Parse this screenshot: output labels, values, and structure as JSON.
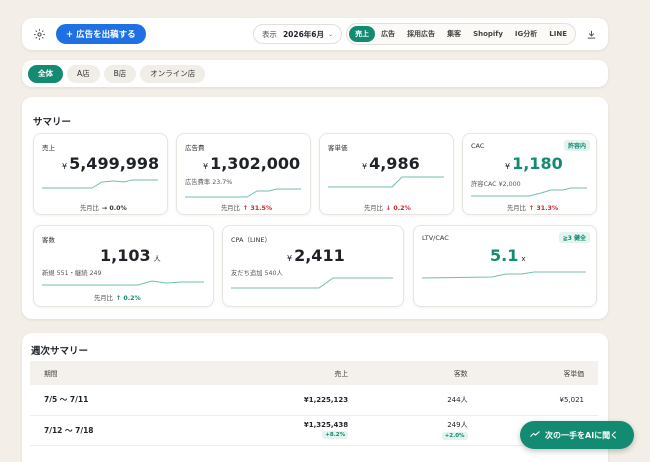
{
  "topbar": {
    "cta_label": "+ 広告を出稿する",
    "period_label": "表示",
    "period_value": "2026年6月",
    "tabs": [
      "売上",
      "広告",
      "採用広告",
      "集客",
      "Shopify",
      "IG分析",
      "LINE"
    ]
  },
  "stores": [
    "全体",
    "A店",
    "B店",
    "オンライン店"
  ],
  "summary": {
    "title": "サマリー",
    "sales": {
      "title": "売上",
      "yen": "¥",
      "value": "5,499,998",
      "cmp_label": "先月比",
      "cmp_value": "→ 0.0%"
    },
    "ad_cost": {
      "title": "広告費",
      "yen": "¥",
      "value": "1,302,000",
      "sub": "広告費率 23.7%",
      "cmp_label": "先月比",
      "cmp_value": "↑ 31.5%"
    },
    "avg_price": {
      "title": "客単価",
      "yen": "¥",
      "value": "4,986",
      "cmp_label": "先月比",
      "cmp_value": "↓ 0.2%"
    },
    "cac": {
      "title": "CAC",
      "badge": "許容内",
      "yen": "¥",
      "value": "1,180",
      "sub": "許容CAC ¥2,000",
      "cmp_label": "先月比",
      "cmp_value": "↑ 31.3%"
    },
    "customers": {
      "title": "客数",
      "value": "1,103",
      "unit": "人",
      "sub": "新規 551・継続 249",
      "cmp_label": "先月比",
      "cmp_value": "↑ 0.2%"
    },
    "cpa": {
      "title": "CPA（LINE）",
      "yen": "¥",
      "value": "2,411",
      "sub": "友だち追加 540人"
    },
    "ltv_cac": {
      "title": "LTV/CAC",
      "badge": "≧3 健全",
      "value": "5.1",
      "unit": "x"
    }
  },
  "weekly": {
    "title": "週次サマリー",
    "headers": [
      "期間",
      "売上",
      "客数",
      "客単価"
    ],
    "rows": [
      {
        "period": "7/5 〜 7/11",
        "sales": "¥1,225,123",
        "sales_chg": "",
        "customers": "244人",
        "cust_chg": "",
        "avg": "¥5,021"
      },
      {
        "period": "7/12 〜 7/18",
        "sales": "¥1,325,438",
        "sales_chg": "+8.2%",
        "customers": "249人",
        "cust_chg": "+2.0%",
        "avg": ""
      }
    ]
  },
  "float_button": {
    "label": "次の一手をAIに聞く"
  },
  "colors": {
    "accent": "#138a72",
    "cta": "#1f6fe5",
    "negative": "#c62828"
  }
}
